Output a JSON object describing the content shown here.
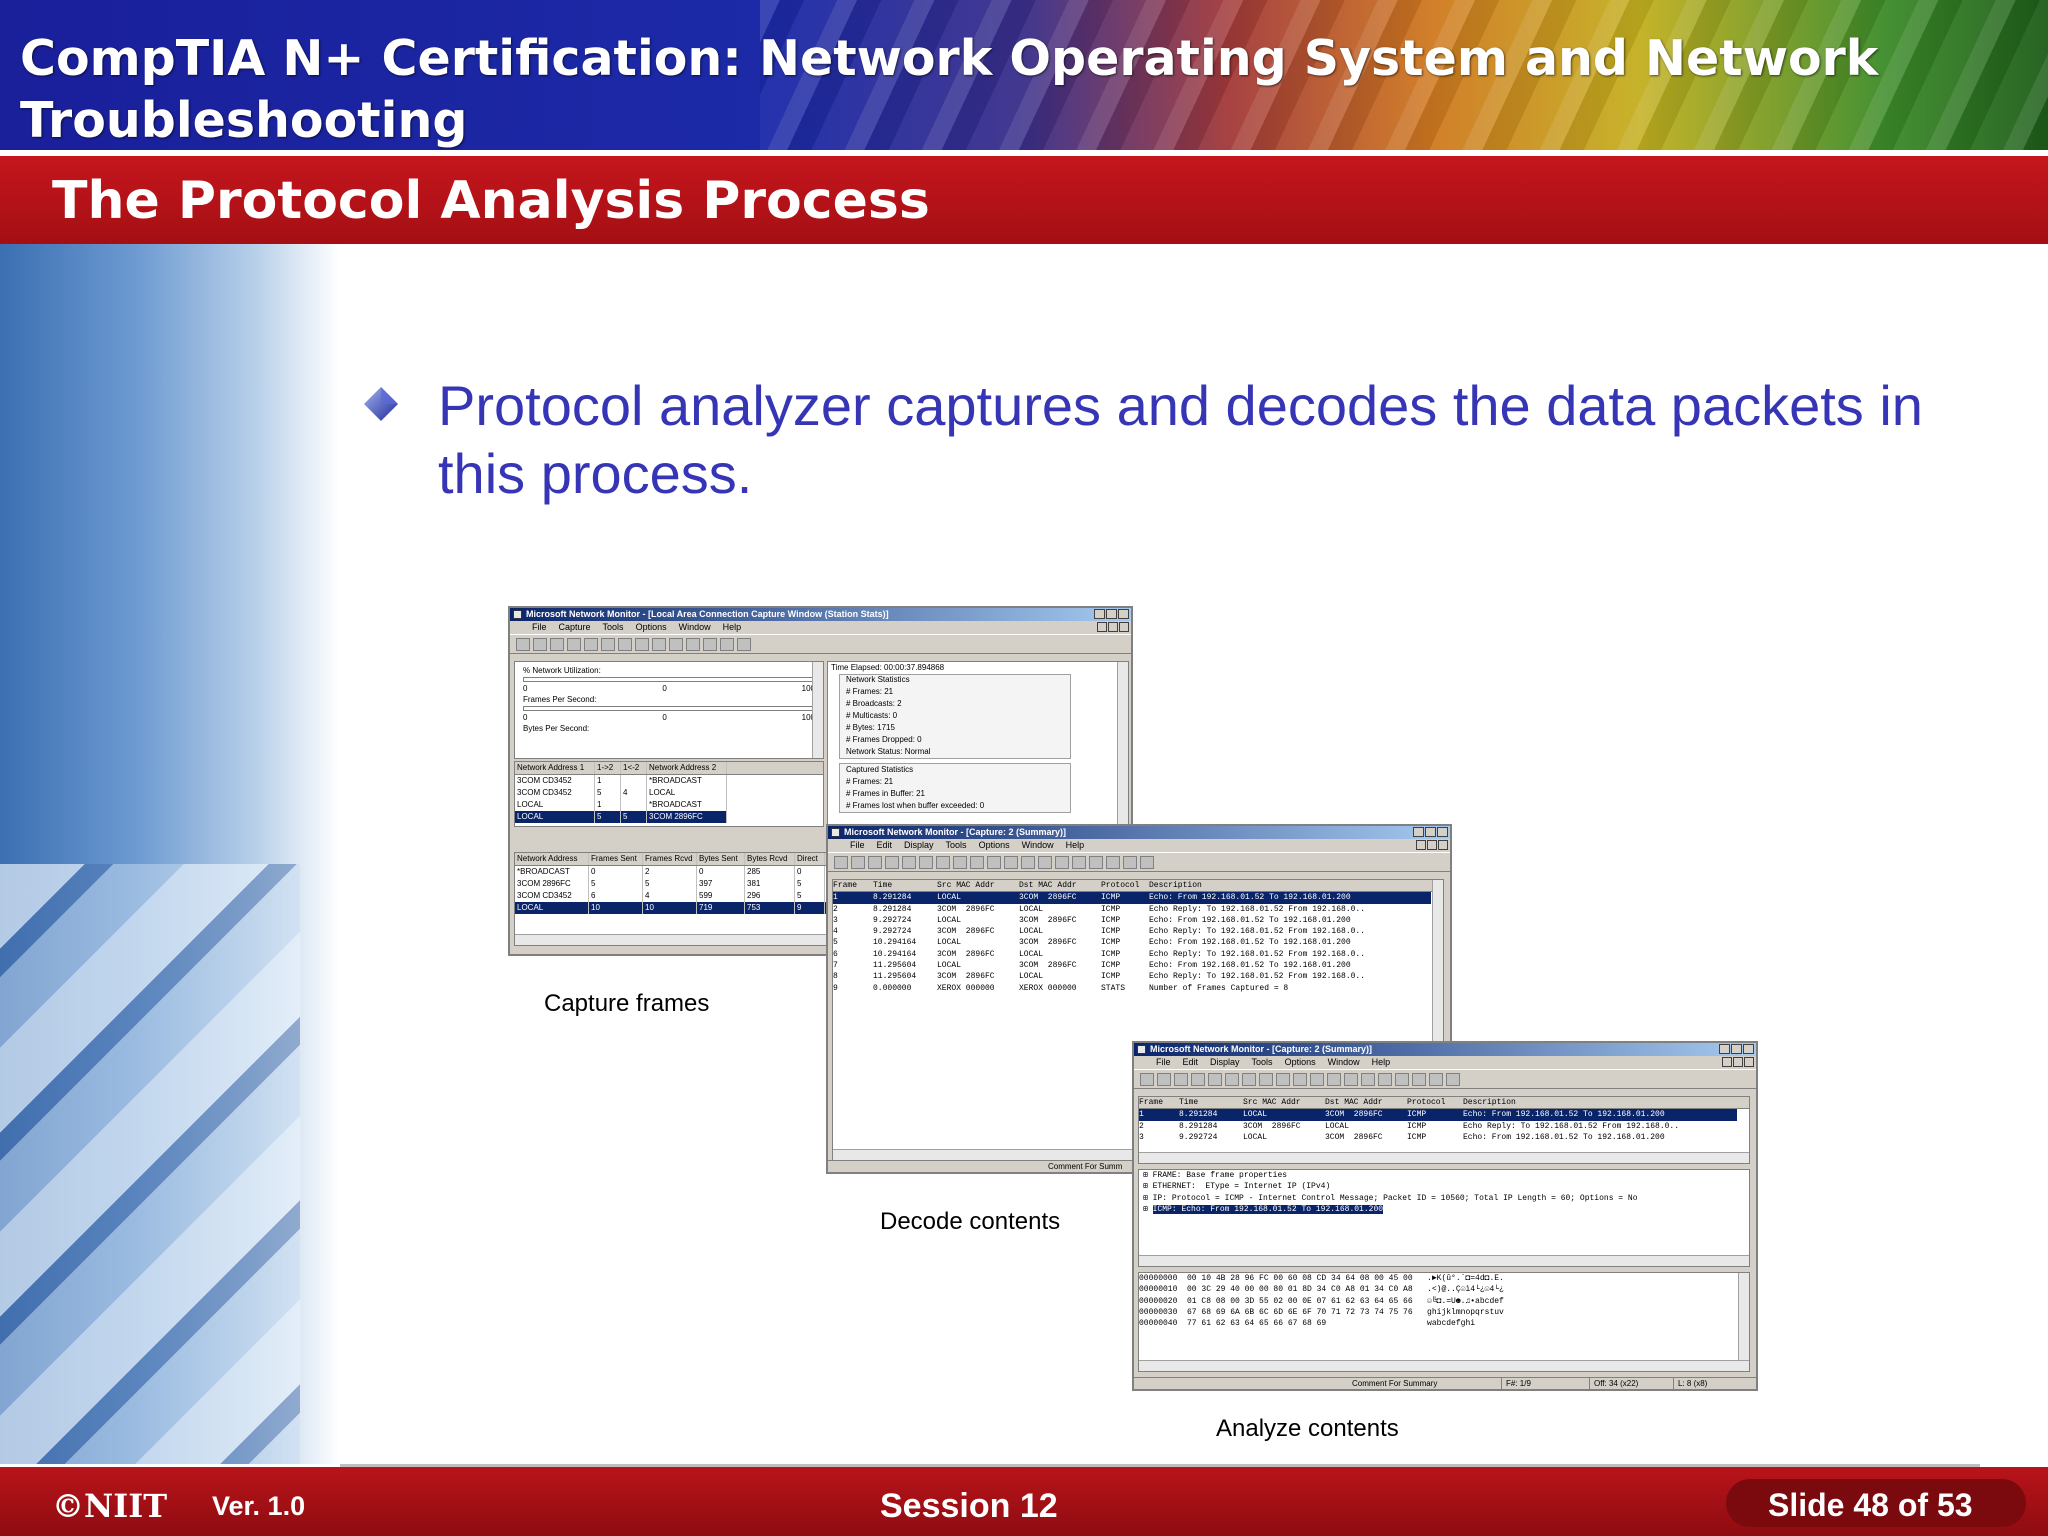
{
  "header": {
    "course_title": "CompTIA N+ Certification:  Network  Operating System and Network Troubleshooting",
    "section_title": "The Protocol Analysis Process"
  },
  "bullet": {
    "icon": "diamond-bullet-icon",
    "text": "Protocol analyzer captures and decodes the data packets in this process."
  },
  "window1": {
    "title": "Microsoft Network Monitor - [Local Area Connection Capture Window (Station Stats)]",
    "menu": [
      "File",
      "Capture",
      "Tools",
      "Options",
      "Window",
      "Help"
    ],
    "graphs": {
      "utilization_label": "% Network Utilization:",
      "fps_label": "Frames Per Second:",
      "bps_label": "Bytes Per Second:",
      "axis_left": "0",
      "axis_mid": "0",
      "axis_right": "100"
    },
    "stats": {
      "time_elapsed": "Time Elapsed: 00:00:37.894868",
      "network_group": "Network Statistics",
      "network_lines": [
        "# Frames: 21",
        "# Broadcasts: 2",
        "# Multicasts: 0",
        "# Bytes: 1715",
        "# Frames Dropped: 0",
        "Network Status: Normal"
      ],
      "captured_group": "Captured Statistics",
      "captured_lines": [
        "# Frames: 21",
        "# Frames in Buffer: 21",
        "# Frames lost when buffer exceeded: 0"
      ]
    },
    "session_table": {
      "headers": [
        "Network Address 1",
        "1->2",
        "1<-2",
        "Network Address 2"
      ],
      "rows": [
        [
          "3COM  CD3452",
          "1",
          "",
          "*BROADCAST"
        ],
        [
          "3COM  CD3452",
          "5",
          "4",
          "LOCAL"
        ],
        [
          "LOCAL",
          "1",
          "",
          "*BROADCAST"
        ],
        [
          "LOCAL",
          "5",
          "5",
          "3COM  2896FC"
        ]
      ]
    },
    "station_table": {
      "headers": [
        "Network Address",
        "Frames Sent",
        "Frames Rcvd",
        "Bytes Sent",
        "Bytes Rcvd",
        "Direct"
      ],
      "rows": [
        [
          "*BROADCAST",
          "0",
          "2",
          "0",
          "285",
          "0"
        ],
        [
          "3COM  2896FC",
          "5",
          "5",
          "397",
          "381",
          "5"
        ],
        [
          "3COM  CD3452",
          "6",
          "4",
          "599",
          "296",
          "5"
        ],
        [
          "LOCAL",
          "10",
          "10",
          "719",
          "753",
          "9"
        ]
      ]
    }
  },
  "window2": {
    "title": "Microsoft Network Monitor - [Capture: 2 (Summary)]",
    "menu": [
      "File",
      "Edit",
      "Display",
      "Tools",
      "Options",
      "Window",
      "Help"
    ],
    "headers": [
      "Frame",
      "Time",
      "Src MAC Addr",
      "Dst MAC Addr",
      "Protocol",
      "Description"
    ],
    "rows": [
      [
        "1",
        "8.291284",
        "LOCAL",
        "3COM  2896FC",
        "ICMP",
        "Echo: From 192.168.01.52 To 192.168.01.200"
      ],
      [
        "2",
        "8.291284",
        "3COM  2896FC",
        "LOCAL",
        "ICMP",
        "Echo Reply: To 192.168.01.52 From 192.168.0.."
      ],
      [
        "3",
        "9.292724",
        "LOCAL",
        "3COM  2896FC",
        "ICMP",
        "Echo: From 192.168.01.52 To 192.168.01.200"
      ],
      [
        "4",
        "9.292724",
        "3COM  2896FC",
        "LOCAL",
        "ICMP",
        "Echo Reply: To 192.168.01.52 From 192.168.0.."
      ],
      [
        "5",
        "10.294164",
        "LOCAL",
        "3COM  2896FC",
        "ICMP",
        "Echo: From 192.168.01.52 To 192.168.01.200"
      ],
      [
        "6",
        "10.294164",
        "3COM  2896FC",
        "LOCAL",
        "ICMP",
        "Echo Reply: To 192.168.01.52 From 192.168.0.."
      ],
      [
        "7",
        "11.295604",
        "LOCAL",
        "3COM  2896FC",
        "ICMP",
        "Echo: From 192.168.01.52 To 192.168.01.200"
      ],
      [
        "8",
        "11.295604",
        "3COM  2896FC",
        "LOCAL",
        "ICMP",
        "Echo Reply: To 192.168.01.52 From 192.168.0.."
      ],
      [
        "9",
        "0.000000",
        "XEROX 000000",
        "XEROX 000000",
        "STATS",
        "Number of Frames Captured = 8"
      ]
    ],
    "status": "Comment For Summ"
  },
  "window3": {
    "title": "Microsoft Network Monitor - [Capture: 2 (Summary)]",
    "menu": [
      "File",
      "Edit",
      "Display",
      "Tools",
      "Options",
      "Window",
      "Help"
    ],
    "headers": [
      "Frame",
      "Time",
      "Src MAC Addr",
      "Dst MAC Addr",
      "Protocol",
      "Description"
    ],
    "rows": [
      [
        "1",
        "8.291284",
        "LOCAL",
        "3COM  2896FC",
        "ICMP",
        "Echo: From 192.168.01.52 To 192.168.01.200"
      ],
      [
        "2",
        "8.291284",
        "3COM  2896FC",
        "LOCAL",
        "ICMP",
        "Echo Reply: To 192.168.01.52 From 192.168.0.."
      ],
      [
        "3",
        "9.292724",
        "LOCAL",
        "3COM  2896FC",
        "ICMP",
        "Echo: From 192.168.01.52 To 192.168.01.200"
      ]
    ],
    "detail_lines": [
      "FRAME: Base frame properties",
      "ETHERNET:  EType = Internet IP (IPv4)",
      "IP: Protocol = ICMP - Internet Control Message; Packet ID = 10560; Total IP Length = 60; Options = No",
      "ICMP: Echo: From 192.168.01.52 To 192.168.01.200"
    ],
    "hex_lines": [
      "00000000  00 10 4B 28 96 FC 00 60 08 CD 34 64 08 00 45 00   .►K(û°.`◘=4d◘.E.",
      "00000010  00 3C 29 40 00 00 80 01 8D 34 C0 A8 01 34 C0 A8   .<)@..Ç☺ì4└¿☺4└¿",
      "00000020  01 C8 08 00 3D 55 02 00 0E 07 61 62 63 64 65 66   ☺╚◘.=U☻.♫•abcdef",
      "00000030  67 68 69 6A 6B 6C 6D 6E 6F 70 71 72 73 74 75 76   ghijklmnopqrstuv",
      "00000040  77 61 62 63 64 65 66 67 68 69                     wabcdefghi"
    ],
    "status": {
      "comment": "Comment For Summary",
      "frame": "F#: 1/9",
      "offset": "Off: 34 (x22)",
      "length": "L: 8 (x8)"
    }
  },
  "captions": {
    "capture": "Capture frames",
    "decode": "Decode contents",
    "analyze": "Analyze contents"
  },
  "footer": {
    "logo": "©NIIT",
    "version": "Ver.  1.0",
    "session": "Session 12",
    "slide": "Slide 48 of 53"
  },
  "colors": {
    "header_blue": "#1a1f9a",
    "title_red": "#c4161c",
    "bullet_text": "#3535b5",
    "footer_red": "#a40f14"
  }
}
